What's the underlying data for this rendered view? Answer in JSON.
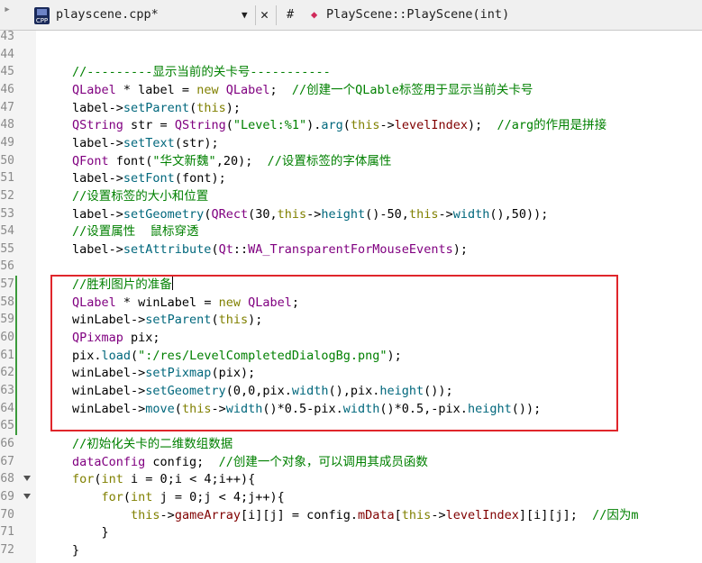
{
  "toolbar": {
    "file_name": "playscene.cpp*",
    "hash_label": "#",
    "function_name": "PlayScene::PlayScene(int)",
    "file_icon_label": "CPP"
  },
  "editor": {
    "visible_line_numbers": [
      "43",
      "44",
      "45",
      "46",
      "47",
      "48",
      "49",
      "50",
      "51",
      "52",
      "53",
      "54",
      "55",
      "56",
      "57",
      "58",
      "59",
      "60",
      "61",
      "62",
      "63",
      "64",
      "65",
      "66",
      "67",
      "68",
      "69",
      "70",
      "71",
      "72"
    ],
    "lines": [
      [],
      [],
      [
        {
          "t": "//---------显示当前的关卡号-----------",
          "c": "comment"
        }
      ],
      [
        {
          "t": "QLabel",
          "c": "type"
        },
        {
          "t": " * label = ",
          "c": "plain"
        },
        {
          "t": "new",
          "c": "kw"
        },
        {
          "t": " ",
          "c": "plain"
        },
        {
          "t": "QLabel",
          "c": "type"
        },
        {
          "t": ";  ",
          "c": "plain"
        },
        {
          "t": "//创建一个QLable标签用于显示当前关卡号",
          "c": "comment"
        }
      ],
      [
        {
          "t": "label->",
          "c": "plain"
        },
        {
          "t": "setParent",
          "c": "func"
        },
        {
          "t": "(",
          "c": "plain"
        },
        {
          "t": "this",
          "c": "this"
        },
        {
          "t": ");",
          "c": "plain"
        }
      ],
      [
        {
          "t": "QString",
          "c": "type"
        },
        {
          "t": " str = ",
          "c": "plain"
        },
        {
          "t": "QString",
          "c": "type"
        },
        {
          "t": "(",
          "c": "plain"
        },
        {
          "t": "\"Level:%1\"",
          "c": "str"
        },
        {
          "t": ").",
          "c": "plain"
        },
        {
          "t": "arg",
          "c": "func"
        },
        {
          "t": "(",
          "c": "plain"
        },
        {
          "t": "this",
          "c": "this"
        },
        {
          "t": "->",
          "c": "plain"
        },
        {
          "t": "levelIndex",
          "c": "mem"
        },
        {
          "t": ");  ",
          "c": "plain"
        },
        {
          "t": "//arg的作用是拼接",
          "c": "comment"
        }
      ],
      [
        {
          "t": "label->",
          "c": "plain"
        },
        {
          "t": "setText",
          "c": "func"
        },
        {
          "t": "(str);",
          "c": "plain"
        }
      ],
      [
        {
          "t": "QFont",
          "c": "type"
        },
        {
          "t": " font(",
          "c": "plain"
        },
        {
          "t": "\"华文新魏\"",
          "c": "str"
        },
        {
          "t": ",20);  ",
          "c": "plain"
        },
        {
          "t": "//设置标签的字体属性",
          "c": "comment"
        }
      ],
      [
        {
          "t": "label->",
          "c": "plain"
        },
        {
          "t": "setFont",
          "c": "func"
        },
        {
          "t": "(font);",
          "c": "plain"
        }
      ],
      [
        {
          "t": "//设置标签的大小和位置",
          "c": "comment"
        }
      ],
      [
        {
          "t": "label->",
          "c": "plain"
        },
        {
          "t": "setGeometry",
          "c": "func"
        },
        {
          "t": "(",
          "c": "plain"
        },
        {
          "t": "QRect",
          "c": "type"
        },
        {
          "t": "(30,",
          "c": "plain"
        },
        {
          "t": "this",
          "c": "this"
        },
        {
          "t": "->",
          "c": "plain"
        },
        {
          "t": "height",
          "c": "func"
        },
        {
          "t": "()-50,",
          "c": "plain"
        },
        {
          "t": "this",
          "c": "this"
        },
        {
          "t": "->",
          "c": "plain"
        },
        {
          "t": "width",
          "c": "func"
        },
        {
          "t": "(),50));",
          "c": "plain"
        }
      ],
      [
        {
          "t": "//设置属性  鼠标穿透",
          "c": "comment"
        }
      ],
      [
        {
          "t": "label->",
          "c": "plain"
        },
        {
          "t": "setAttribute",
          "c": "func"
        },
        {
          "t": "(",
          "c": "plain"
        },
        {
          "t": "Qt",
          "c": "type"
        },
        {
          "t": "::",
          "c": "plain"
        },
        {
          "t": "WA_TransparentForMouseEvents",
          "c": "type"
        },
        {
          "t": ");",
          "c": "plain"
        }
      ],
      [],
      [
        {
          "t": "//胜利图片的准备",
          "c": "comment"
        }
      ],
      [
        {
          "t": "QLabel",
          "c": "type"
        },
        {
          "t": " * winLabel = ",
          "c": "plain"
        },
        {
          "t": "new",
          "c": "kw"
        },
        {
          "t": " ",
          "c": "plain"
        },
        {
          "t": "QLabel",
          "c": "type"
        },
        {
          "t": ";",
          "c": "plain"
        }
      ],
      [
        {
          "t": "winLabel->",
          "c": "plain"
        },
        {
          "t": "setParent",
          "c": "func"
        },
        {
          "t": "(",
          "c": "plain"
        },
        {
          "t": "this",
          "c": "this"
        },
        {
          "t": ");",
          "c": "plain"
        }
      ],
      [
        {
          "t": "QPixmap",
          "c": "type"
        },
        {
          "t": " pix;",
          "c": "plain"
        }
      ],
      [
        {
          "t": "pix.",
          "c": "plain"
        },
        {
          "t": "load",
          "c": "func"
        },
        {
          "t": "(",
          "c": "plain"
        },
        {
          "t": "\":/res/LevelCompletedDialogBg.png\"",
          "c": "str"
        },
        {
          "t": ");",
          "c": "plain"
        }
      ],
      [
        {
          "t": "winLabel->",
          "c": "plain"
        },
        {
          "t": "setPixmap",
          "c": "func"
        },
        {
          "t": "(pix);",
          "c": "plain"
        }
      ],
      [
        {
          "t": "winLabel->",
          "c": "plain"
        },
        {
          "t": "setGeometry",
          "c": "func"
        },
        {
          "t": "(0,0,pix.",
          "c": "plain"
        },
        {
          "t": "width",
          "c": "func"
        },
        {
          "t": "(),pix.",
          "c": "plain"
        },
        {
          "t": "height",
          "c": "func"
        },
        {
          "t": "());",
          "c": "plain"
        }
      ],
      [
        {
          "t": "winLabel->",
          "c": "plain"
        },
        {
          "t": "move",
          "c": "func"
        },
        {
          "t": "(",
          "c": "plain"
        },
        {
          "t": "this",
          "c": "this"
        },
        {
          "t": "->",
          "c": "plain"
        },
        {
          "t": "width",
          "c": "func"
        },
        {
          "t": "()*0.5-pix.",
          "c": "plain"
        },
        {
          "t": "width",
          "c": "func"
        },
        {
          "t": "()*0.5,-pix.",
          "c": "plain"
        },
        {
          "t": "height",
          "c": "func"
        },
        {
          "t": "());",
          "c": "plain"
        }
      ],
      [],
      [
        {
          "t": "//初始化关卡的二维数组数据",
          "c": "comment"
        }
      ],
      [
        {
          "t": "dataConfig",
          "c": "type"
        },
        {
          "t": " config;  ",
          "c": "plain"
        },
        {
          "t": "//创建一个对象，可以调用其成员函数",
          "c": "comment"
        }
      ],
      [
        {
          "t": "for",
          "c": "kw"
        },
        {
          "t": "(",
          "c": "plain"
        },
        {
          "t": "int",
          "c": "kw"
        },
        {
          "t": " i = 0;i < 4;i++){",
          "c": "plain"
        }
      ],
      [
        {
          "t": "    ",
          "c": "plain"
        },
        {
          "t": "for",
          "c": "kw"
        },
        {
          "t": "(",
          "c": "plain"
        },
        {
          "t": "int",
          "c": "kw"
        },
        {
          "t": " j = 0;j < 4;j++){",
          "c": "plain"
        }
      ],
      [
        {
          "t": "        ",
          "c": "plain"
        },
        {
          "t": "this",
          "c": "this"
        },
        {
          "t": "->",
          "c": "plain"
        },
        {
          "t": "gameArray",
          "c": "mem"
        },
        {
          "t": "[i][j] = config.",
          "c": "plain"
        },
        {
          "t": "mData",
          "c": "mem"
        },
        {
          "t": "[",
          "c": "plain"
        },
        {
          "t": "this",
          "c": "this"
        },
        {
          "t": "->",
          "c": "plain"
        },
        {
          "t": "levelIndex",
          "c": "mem"
        },
        {
          "t": "][i][j];  ",
          "c": "plain"
        },
        {
          "t": "//因为m",
          "c": "comment"
        }
      ],
      [
        {
          "t": "    }",
          "c": "plain"
        }
      ],
      [
        {
          "t": "}",
          "c": "plain"
        }
      ]
    ]
  }
}
